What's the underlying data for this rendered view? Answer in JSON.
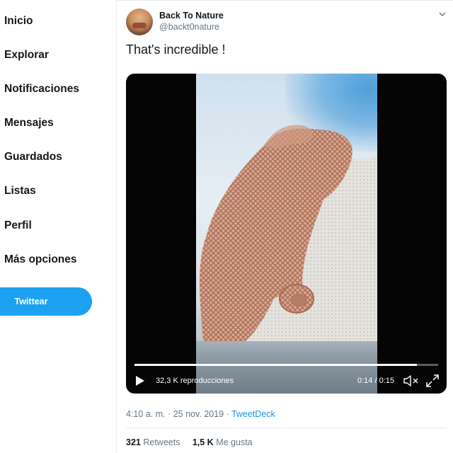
{
  "sidebar": {
    "items": [
      {
        "label": "Inicio"
      },
      {
        "label": "Explorar"
      },
      {
        "label": "Notificaciones"
      },
      {
        "label": "Mensajes"
      },
      {
        "label": "Guardados"
      },
      {
        "label": "Listas"
      },
      {
        "label": "Perfil"
      },
      {
        "label": "Más opciones"
      }
    ],
    "tweet_button": "Twittear"
  },
  "tweet": {
    "author_name": "Back To Nature",
    "author_handle": "@backt0nature",
    "text": "That's incredible !",
    "video": {
      "views": "32,3 K reproducciones",
      "time": "0:14 / 0:15",
      "progress": 0.93
    },
    "timestamp": "4:10 a. m. · 25 nov. 2019 · ",
    "source": "TweetDeck",
    "retweets_count": "321",
    "retweets_label": "Retweets",
    "likes_count": "1,5 K",
    "likes_label": "Me gusta"
  },
  "colors": {
    "accent": "#1da1f2",
    "secondary_text": "#657786"
  }
}
